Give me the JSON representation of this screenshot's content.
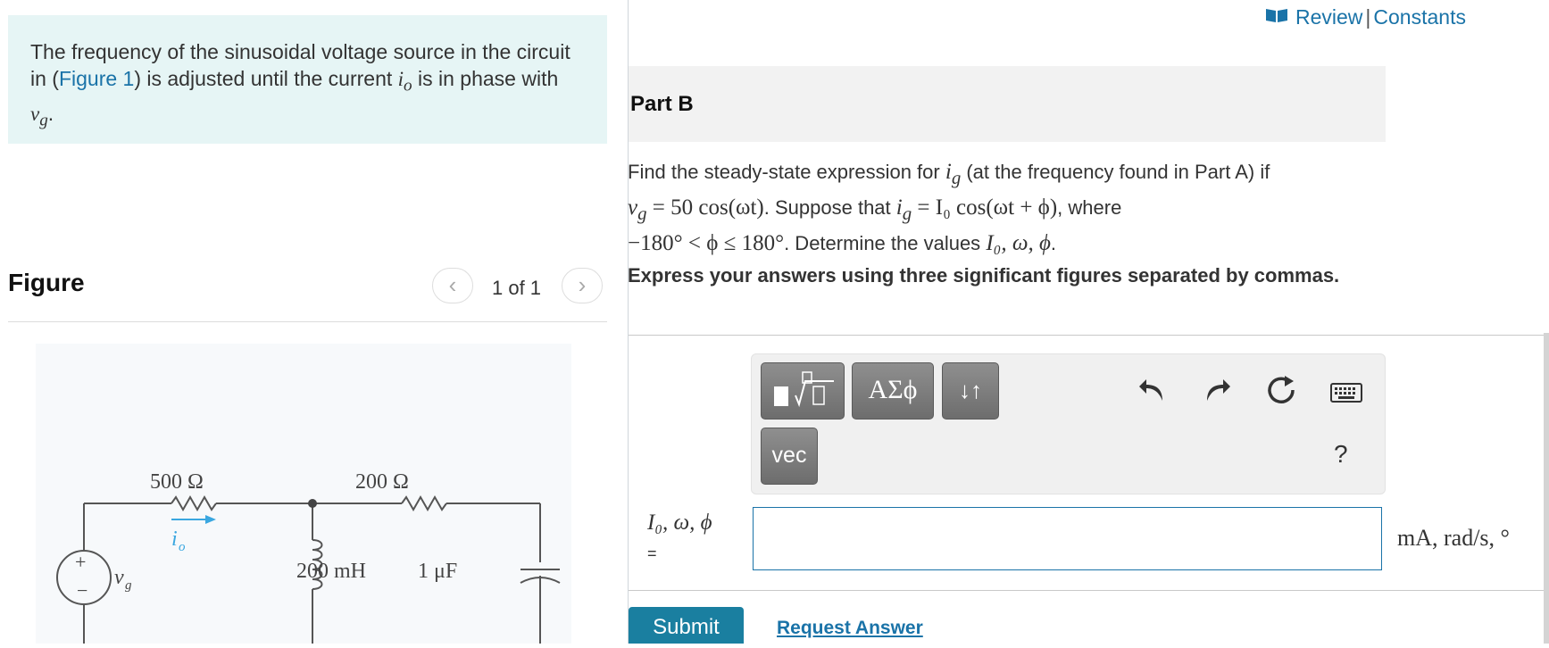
{
  "intro": {
    "t1": "The frequency of the sinusoidal voltage source in the circuit in (",
    "link": "Figure 1",
    "t2": ") is adjusted until the current ",
    "v1": "i",
    "v1sub": "o",
    "t3": " is in phase with ",
    "v2": "v",
    "v2sub": "g",
    "t4": "."
  },
  "figure": {
    "title": "Figure",
    "count": "1 of 1",
    "prev": "‹",
    "next": "›",
    "circuit": {
      "r1": "500 Ω",
      "r2": "200 Ω",
      "inductor": "200 mH",
      "capacitor": "1 μF",
      "source": "v",
      "source_sub": "g",
      "current": "i",
      "current_sub": "o",
      "plus": "+",
      "minus": "−"
    }
  },
  "topbar": {
    "review": "Review",
    "separator": "|",
    "constants": "Constants"
  },
  "part": {
    "title": "Part B"
  },
  "question": {
    "a1": "Find the steady-state expression for ",
    "ig": "i",
    "g": "g",
    "a2": " (at the frequency found in Part A) if",
    "vg": "v",
    "b1": " = 50 cos(ωt)",
    "b2": ". Suppose that ",
    "b3": " = I₀ cos(ωt + ϕ)",
    "b4": ", where",
    "c1": "−180° < ϕ ≤ 180°",
    "c2": ". Determine the values ",
    "c3": "I₀, ω, ϕ",
    "c4": "."
  },
  "instruction": "Express your answers using three significant figures separated by commas.",
  "toolbar": {
    "greek": "ΑΣϕ",
    "arrows": "↓↑",
    "vec": "vec",
    "help": "?"
  },
  "answer": {
    "label": "I₀, ω, ϕ",
    "equals": "=",
    "value": "",
    "units": "mA, rad/s, °"
  },
  "actions": {
    "submit": "Submit",
    "request": "Request Answer"
  },
  "colors": {
    "intro_bg": "#e6f5f5",
    "link": "#1a73a8",
    "submit_bg": "#1a7fa0",
    "current_arrow": "#3aa7e0"
  }
}
